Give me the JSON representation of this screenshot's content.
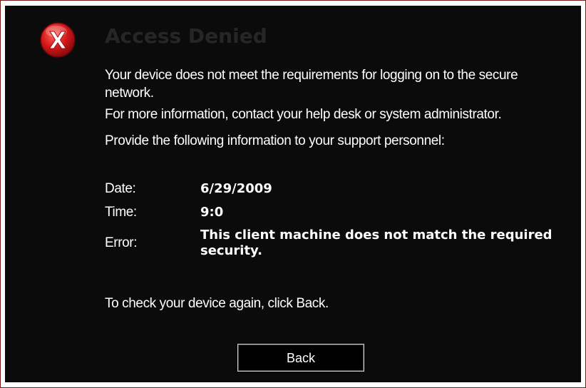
{
  "dialog": {
    "title": "Access Denied",
    "icon": "error-icon",
    "messages": [
      "Your device does not meet the requirements for logging on to the secure network.",
      "For more information, contact your help desk or system administrator.",
      "Provide the following information to your support personnel:"
    ],
    "info": {
      "date_label": "Date:",
      "date_value": "6/29/2009",
      "time_label": "Time:",
      "time_value": "9:0",
      "error_label": "Error:",
      "error_value": "This client machine does not match the required security."
    },
    "back_hint": "To check your device again, click Back.",
    "back_button_label": "Back"
  },
  "colors": {
    "background": "#0b0b0b",
    "text": "#ffffff",
    "title": "#262626",
    "icon_red": "#d8191c"
  }
}
